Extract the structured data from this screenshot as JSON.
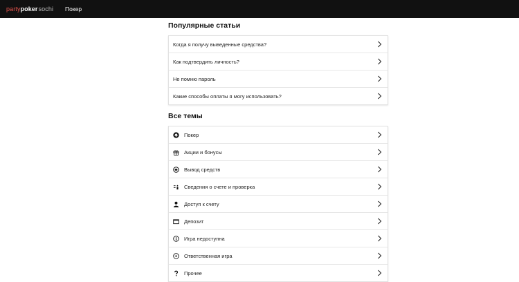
{
  "header": {
    "brand_party": "party",
    "brand_poker": "poker",
    "brand_sochi": "sochi",
    "nav_poker": "Покер"
  },
  "popular": {
    "title": "Популярные статьи",
    "items": [
      {
        "label": "Когда я получу выведенные средства?"
      },
      {
        "label": "Как подтвердить личность?"
      },
      {
        "label": "Не помню пароль"
      },
      {
        "label": "Какие способы оплаты я могу использовать?"
      }
    ]
  },
  "topics": {
    "title": "Все темы",
    "items": [
      {
        "label": "Покер",
        "icon": "spade-icon"
      },
      {
        "label": "Акции и бонусы",
        "icon": "gift-icon"
      },
      {
        "label": "Вывод средств",
        "icon": "withdraw-icon"
      },
      {
        "label": "Сведения о счете и проверка",
        "icon": "account-verification-icon"
      },
      {
        "label": "Доступ к счету",
        "icon": "user-icon"
      },
      {
        "label": "Депозит",
        "icon": "wallet-icon"
      },
      {
        "label": "Игра недоступна",
        "icon": "info-icon"
      },
      {
        "label": "Ответственная игра",
        "icon": "responsible-gaming-icon"
      },
      {
        "label": "Прочее",
        "icon": "question-icon"
      }
    ]
  }
}
